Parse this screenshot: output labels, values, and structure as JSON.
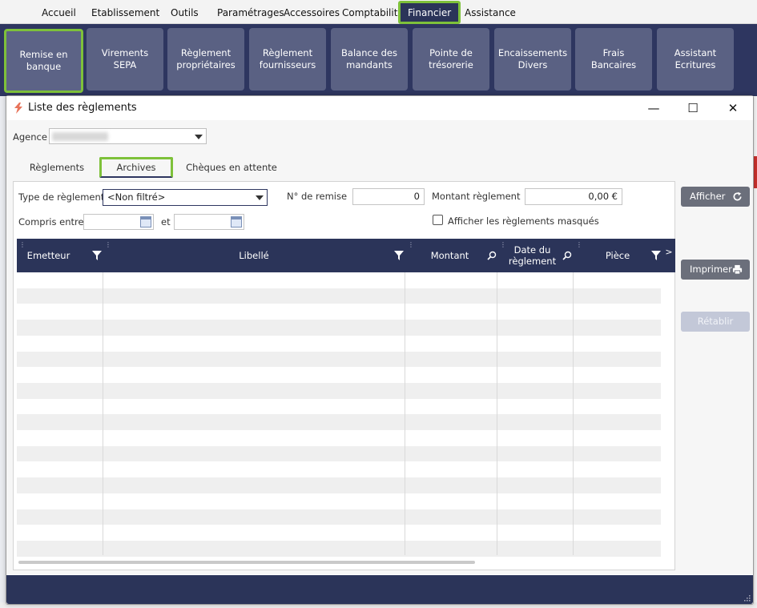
{
  "menu": {
    "items": [
      {
        "label": "Accueil"
      },
      {
        "label": "Etablissement"
      },
      {
        "label": "Outils"
      },
      {
        "label": "Paramétrages"
      },
      {
        "label": "Accessoires"
      },
      {
        "label": "Comptabilité"
      },
      {
        "label": "Financier",
        "active": true
      },
      {
        "label": "Assistance"
      }
    ]
  },
  "ribbon": {
    "buttons": [
      {
        "line1": "Remise en banque",
        "line2": "",
        "selected": true
      },
      {
        "line1": "Virements",
        "line2": "SEPA"
      },
      {
        "line1": "Règlement",
        "line2": "propriétaires"
      },
      {
        "line1": "Règlement",
        "line2": "fournisseurs"
      },
      {
        "line1": "Balance des",
        "line2": "mandants"
      },
      {
        "line1": "Pointe de",
        "line2": "trésorerie"
      },
      {
        "line1": "Encaissements",
        "line2": "Divers"
      },
      {
        "line1": "Frais",
        "line2": "Bancaires"
      },
      {
        "line1": "Assistant",
        "line2": "Ecritures"
      }
    ]
  },
  "dialog": {
    "title": "Liste des règlements",
    "minimize_glyph": "—",
    "maximize_glyph": "☐",
    "close_glyph": "✕"
  },
  "agence": {
    "label": "Agence",
    "value": ""
  },
  "tabs": [
    {
      "label": "Règlements"
    },
    {
      "label": "Archives",
      "active": true
    },
    {
      "label": "Chèques en attente"
    }
  ],
  "filters": {
    "type_label": "Type de règlement",
    "type_value": "<Non filtré>",
    "remise_label": "N° de remise",
    "remise_value": "0",
    "montant_label": "Montant règlement",
    "montant_value": "0,00 €",
    "compris_label": "Compris entre",
    "et_label": "et",
    "masques_label": "Afficher les règlements masqués"
  },
  "grid": {
    "columns": [
      {
        "label": "Emetteur",
        "icon": "filter-icon"
      },
      {
        "label": "Libellé",
        "icon": "filter-icon"
      },
      {
        "label": "Montant",
        "icon": "search-icon"
      },
      {
        "label": "Date du règlement",
        "line1": "Date du",
        "line2": "règlement",
        "icon": "search-icon"
      },
      {
        "label": "Pièce",
        "icon": "filter-icon"
      }
    ],
    "more_glyph": ">",
    "rows": []
  },
  "actions": {
    "afficher": "Afficher",
    "imprimer": "Imprimer",
    "retablir": "Rétablir"
  },
  "colors": {
    "accent_highlight": "#7ec13a",
    "navy": "#2b3459",
    "ribbon_button": "#5a6183"
  }
}
